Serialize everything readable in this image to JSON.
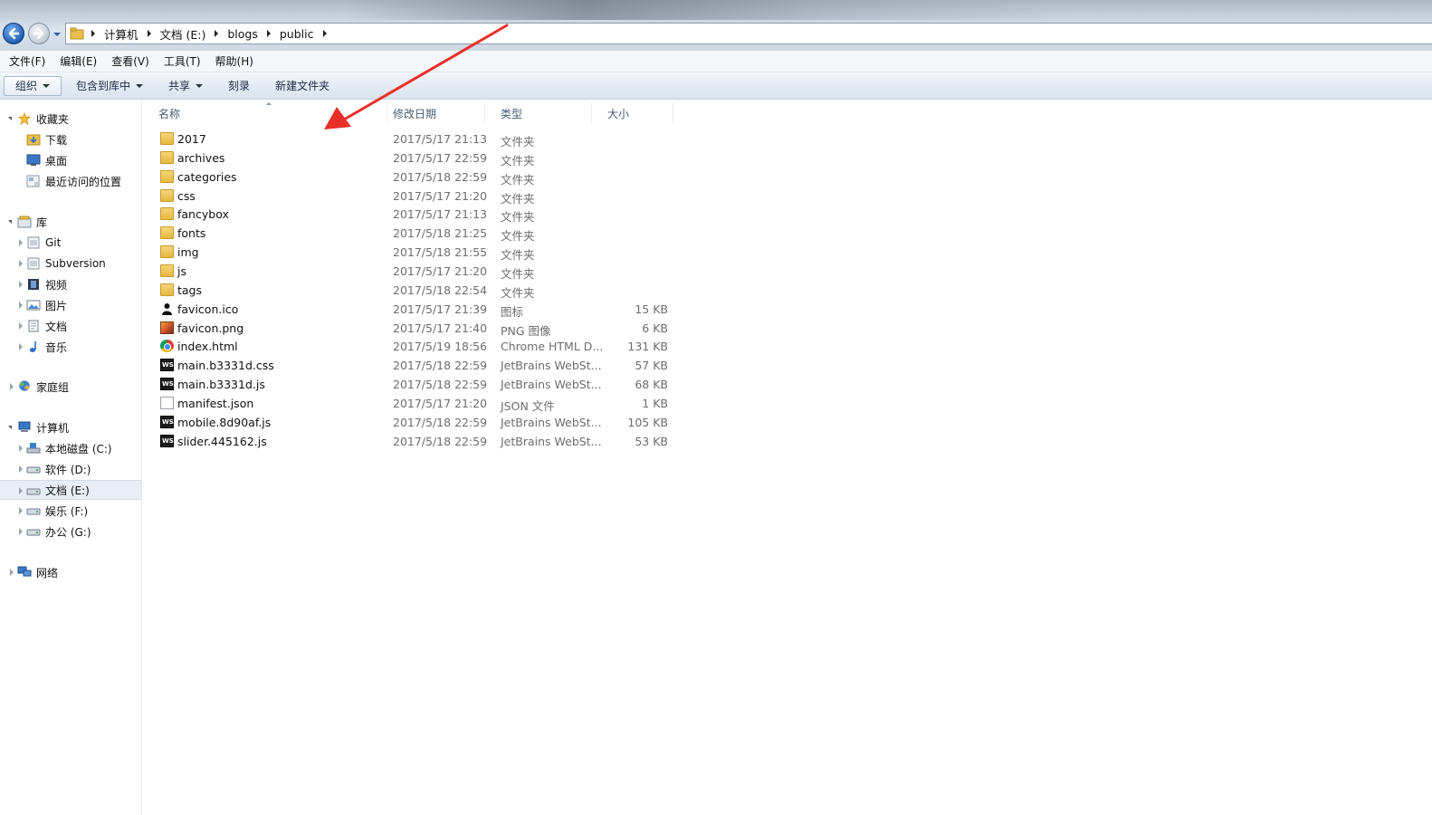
{
  "address": {
    "crumbs": [
      "计算机",
      "文档 (E:)",
      "blogs",
      "public"
    ]
  },
  "menu": [
    "文件(F)",
    "编辑(E)",
    "查看(V)",
    "工具(T)",
    "帮助(H)"
  ],
  "toolbar": {
    "organize": "组织",
    "include_library": "包含到库中",
    "share": "共享",
    "burn": "刻录",
    "new_folder": "新建文件夹"
  },
  "nav": {
    "favorites": "收藏夹",
    "downloads": "下载",
    "desktop": "桌面",
    "recent": "最近访问的位置",
    "libraries": "库",
    "git": "Git",
    "subversion": "Subversion",
    "videos": "视频",
    "pictures": "图片",
    "documents": "文档",
    "music": "音乐",
    "homegroup": "家庭组",
    "computer": "计算机",
    "drive_c": "本地磁盘 (C:)",
    "drive_d": "软件 (D:)",
    "drive_e": "文档 (E:)",
    "drive_f": "娱乐 (F:)",
    "drive_g": "办公 (G:)",
    "network": "网络"
  },
  "columns": {
    "name": "名称",
    "date": "修改日期",
    "type": "类型",
    "size": "大小"
  },
  "files": [
    {
      "name": "2017",
      "date": "2017/5/17 21:13",
      "type": "文件夹",
      "size": "",
      "icon": "folder-icon"
    },
    {
      "name": "archives",
      "date": "2017/5/17 22:59",
      "type": "文件夹",
      "size": "",
      "icon": "folder-icon"
    },
    {
      "name": "categories",
      "date": "2017/5/18 22:59",
      "type": "文件夹",
      "size": "",
      "icon": "folder-icon"
    },
    {
      "name": "css",
      "date": "2017/5/17 21:20",
      "type": "文件夹",
      "size": "",
      "icon": "folder-icon"
    },
    {
      "name": "fancybox",
      "date": "2017/5/17 21:13",
      "type": "文件夹",
      "size": "",
      "icon": "folder-icon"
    },
    {
      "name": "fonts",
      "date": "2017/5/18 21:25",
      "type": "文件夹",
      "size": "",
      "icon": "folder-icon"
    },
    {
      "name": "img",
      "date": "2017/5/18 21:55",
      "type": "文件夹",
      "size": "",
      "icon": "folder-icon"
    },
    {
      "name": "js",
      "date": "2017/5/17 21:20",
      "type": "文件夹",
      "size": "",
      "icon": "folder-icon"
    },
    {
      "name": "tags",
      "date": "2017/5/18 22:54",
      "type": "文件夹",
      "size": "",
      "icon": "folder-icon"
    },
    {
      "name": "favicon.ico",
      "date": "2017/5/17 21:39",
      "type": "图标",
      "size": "15 KB",
      "icon": "ico-file-icon"
    },
    {
      "name": "favicon.png",
      "date": "2017/5/17 21:40",
      "type": "PNG 图像",
      "size": "6 KB",
      "icon": "png-file-icon"
    },
    {
      "name": "index.html",
      "date": "2017/5/19 18:56",
      "type": "Chrome HTML D...",
      "size": "131 KB",
      "icon": "chrome-html-icon"
    },
    {
      "name": "main.b3331d.css",
      "date": "2017/5/18 22:59",
      "type": "JetBrains WebSt...",
      "size": "57 KB",
      "icon": "webstorm-file-icon"
    },
    {
      "name": "main.b3331d.js",
      "date": "2017/5/18 22:59",
      "type": "JetBrains WebSt...",
      "size": "68 KB",
      "icon": "webstorm-file-icon"
    },
    {
      "name": "manifest.json",
      "date": "2017/5/17 21:20",
      "type": "JSON 文件",
      "size": "1 KB",
      "icon": "blank-file-icon"
    },
    {
      "name": "mobile.8d90af.js",
      "date": "2017/5/18 22:59",
      "type": "JetBrains WebSt...",
      "size": "105 KB",
      "icon": "webstorm-file-icon"
    },
    {
      "name": "slider.445162.js",
      "date": "2017/5/18 22:59",
      "type": "JetBrains WebSt...",
      "size": "53 KB",
      "icon": "webstorm-file-icon"
    }
  ],
  "annotation": {
    "arrow_color": "#e8302a"
  }
}
